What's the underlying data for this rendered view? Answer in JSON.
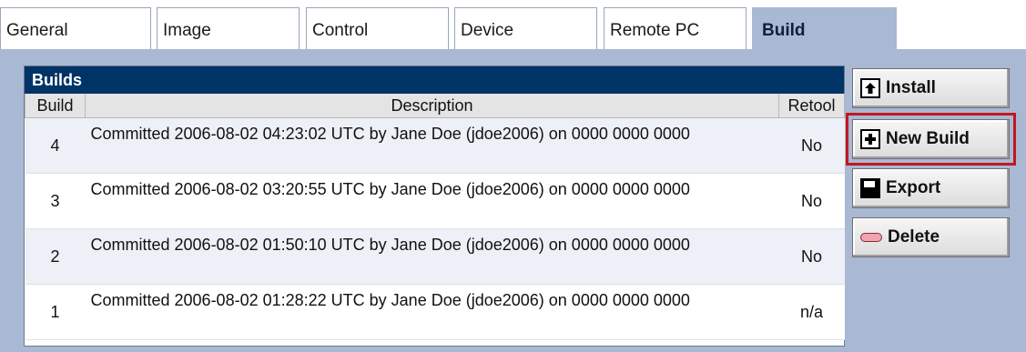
{
  "tabs": [
    {
      "label": "General"
    },
    {
      "label": "Image"
    },
    {
      "label": "Control"
    },
    {
      "label": "Device"
    },
    {
      "label": "Remote PC"
    },
    {
      "label": "Build",
      "active": true
    }
  ],
  "builds": {
    "title": "Builds",
    "columns": {
      "build": "Build",
      "description": "Description",
      "retool": "Retool"
    },
    "rows": [
      {
        "build": "4",
        "description": "Committed 2006-08-02 04:23:02 UTC by Jane Doe (jdoe2006) on 0000 0000 0000",
        "retool": "No"
      },
      {
        "build": "3",
        "description": "Committed 2006-08-02 03:20:55 UTC by Jane Doe (jdoe2006) on 0000 0000 0000",
        "retool": "No"
      },
      {
        "build": "2",
        "description": "Committed 2006-08-02 01:50:10 UTC by Jane Doe (jdoe2006) on 0000 0000 0000",
        "retool": "No"
      },
      {
        "build": "1",
        "description": "Committed 2006-08-02 01:28:22 UTC by Jane Doe (jdoe2006) on 0000 0000 0000",
        "retool": "n/a"
      }
    ]
  },
  "buttons": {
    "install": {
      "label": "Install",
      "icon": "arrow-up-icon"
    },
    "new_build": {
      "label": "New Build",
      "icon": "plus-icon",
      "focused": true
    },
    "export": {
      "label": "Export",
      "icon": "save-disk-icon"
    },
    "delete": {
      "label": "Delete",
      "icon": "minus-icon"
    }
  },
  "colors": {
    "panel": "#a9b8d3",
    "title_bar": "#003366",
    "focus_outline": "#c2181f"
  }
}
